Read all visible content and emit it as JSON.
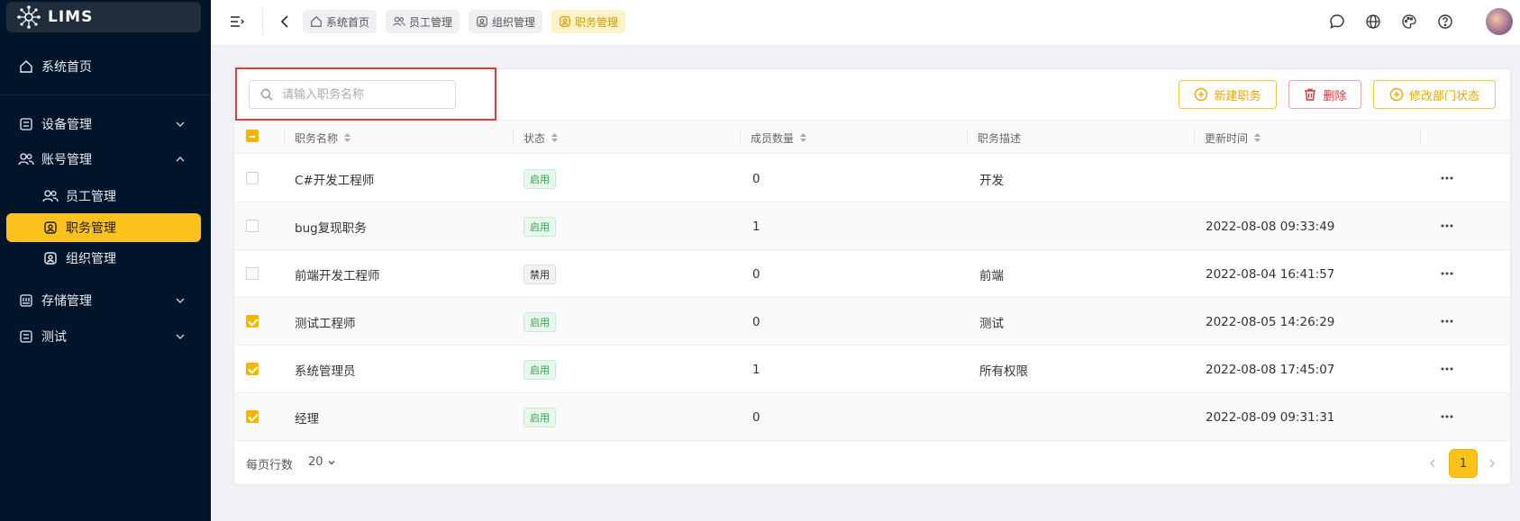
{
  "app": {
    "name": "LIMS"
  },
  "sidebar": {
    "items": [
      {
        "label": "系统首页",
        "icon": "home-icon"
      },
      {
        "label": "设备管理",
        "icon": "grid-icon",
        "expanded": false
      },
      {
        "label": "账号管理",
        "icon": "users-icon",
        "expanded": true
      },
      {
        "label": "员工管理",
        "icon": "users-icon",
        "sub": true
      },
      {
        "label": "职务管理",
        "icon": "badge-icon",
        "sub": true,
        "active": true
      },
      {
        "label": "组织管理",
        "icon": "badge-icon",
        "sub": true
      },
      {
        "label": "存储管理",
        "icon": "storage-icon",
        "expanded": false
      },
      {
        "label": "测试",
        "icon": "grid-icon",
        "expanded": false
      }
    ]
  },
  "header": {
    "tabs": [
      {
        "label": "系统首页",
        "icon": "home-icon"
      },
      {
        "label": "员工管理",
        "icon": "users-icon"
      },
      {
        "label": "组织管理",
        "icon": "badge-icon"
      },
      {
        "label": "职务管理",
        "icon": "badge-icon",
        "active": true
      }
    ],
    "icons": [
      "message-icon",
      "globe-icon",
      "palette-icon",
      "help-icon"
    ]
  },
  "toolbar": {
    "search_placeholder": "请输入职务名称",
    "new_label": "新建职务",
    "delete_label": "删除",
    "status_label": "修改部门状态"
  },
  "table": {
    "columns": [
      "职务名称",
      "状态",
      "成员数量",
      "职务描述",
      "更新时间"
    ],
    "rows": [
      {
        "name": "C#开发工程师",
        "status": "启用",
        "status_on": true,
        "members": "0",
        "desc": "开发",
        "updated": "",
        "checked": false
      },
      {
        "name": "bug复现职务",
        "status": "启用",
        "status_on": true,
        "members": "1",
        "desc": "",
        "updated": "2022-08-08 09:33:49",
        "checked": false
      },
      {
        "name": "前端开发工程师",
        "status": "禁用",
        "status_on": false,
        "members": "0",
        "desc": "前端",
        "updated": "2022-08-04 16:41:57",
        "checked": false
      },
      {
        "name": "测试工程师",
        "status": "启用",
        "status_on": true,
        "members": "0",
        "desc": "测试",
        "updated": "2022-08-05 14:26:29",
        "checked": true
      },
      {
        "name": "系统管理员",
        "status": "启用",
        "status_on": true,
        "members": "1",
        "desc": "所有权限",
        "updated": "2022-08-08 17:45:07",
        "checked": true
      },
      {
        "name": "经理",
        "status": "启用",
        "status_on": true,
        "members": "0",
        "desc": "",
        "updated": "2022-08-09 09:31:31",
        "checked": true
      }
    ]
  },
  "footer": {
    "rows_per_page_label": "每页行数",
    "rows_per_page": "20",
    "current_page": "1"
  },
  "colors": {
    "accent": "#fcc21b",
    "sidebar_bg": "#001529",
    "danger": "#e03131",
    "success": "#2aa64b"
  }
}
